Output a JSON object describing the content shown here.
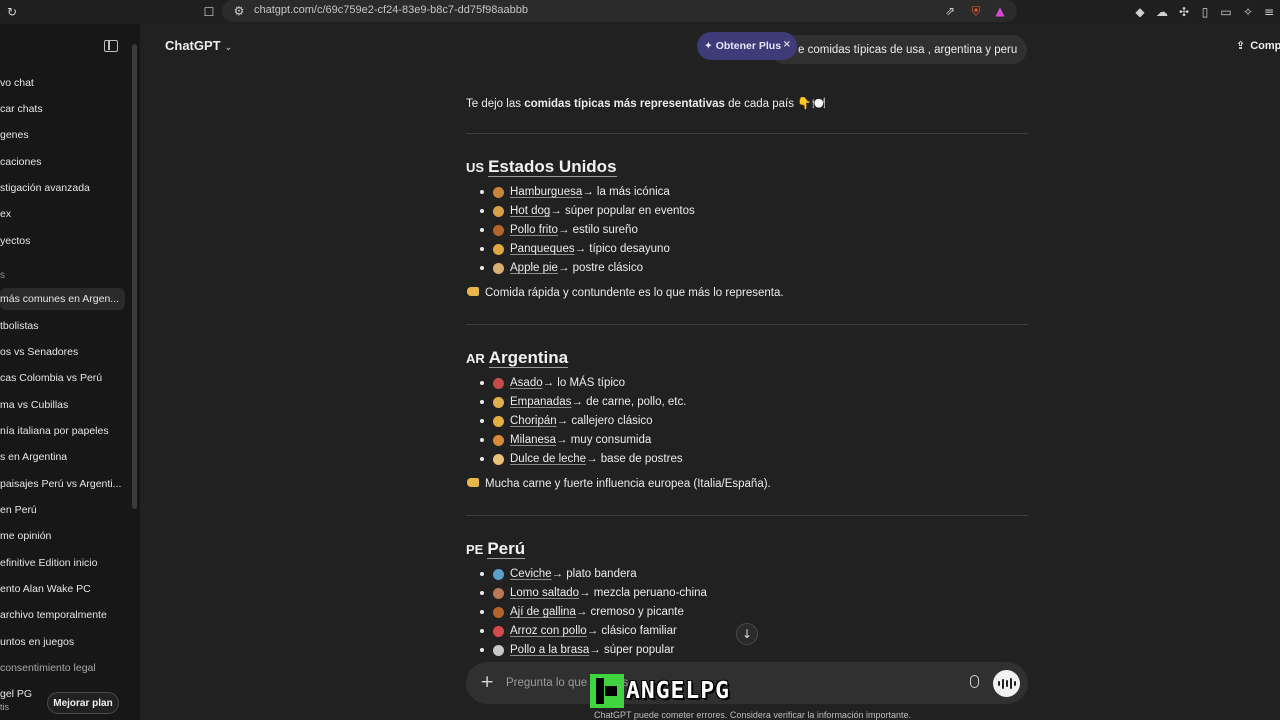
{
  "browser": {
    "url": "chatgpt.com/c/69c759e2-cf24-83e9-b8c7-dd75f98aabbb"
  },
  "sidebar": {
    "items": [
      {
        "label": "vo chat"
      },
      {
        "label": "car chats"
      },
      {
        "label": "genes"
      },
      {
        "label": "caciones"
      },
      {
        "label": "stigación avanzada"
      },
      {
        "label": "ex"
      },
      {
        "label": "yectos"
      }
    ],
    "section_label": "s",
    "chats": [
      {
        "label": " más comunes en Argen..."
      },
      {
        "label": "tbolistas"
      },
      {
        "label": "os vs Senadores"
      },
      {
        "label": "cas Colombia vs Perú"
      },
      {
        "label": "ma vs Cubillas"
      },
      {
        "label": "nía italiana por papeles"
      },
      {
        "label": "s en Argentina"
      },
      {
        "label": " paisajes Perú vs Argenti..."
      },
      {
        "label": " en Perú"
      },
      {
        "label": "me opinión"
      },
      {
        "label": "efinitive Edition inicio"
      },
      {
        "label": "ento Alan Wake PC"
      },
      {
        "label": "archivo temporalmente"
      },
      {
        "label": "untos en juegos"
      },
      {
        "label": " consentimiento legal"
      }
    ],
    "user_line1": "gel PG",
    "user_line2": "tis",
    "upgrade_label": "Mejorar plan"
  },
  "header": {
    "model": "ChatGPT",
    "plus_label": "✦ Obtener Plus",
    "plus_close": "×",
    "user_prompt": "e comidas típicas de usa , argentina y peru",
    "share_label": "Comp"
  },
  "answer": {
    "intro_pre": "Te dejo las ",
    "intro_bold": "comidas típicas más representativas",
    "intro_post": " de cada país 👇🍽️",
    "countries": [
      {
        "code": "US",
        "name": "Estados Unidos",
        "foods": [
          {
            "name": "Hamburguesa",
            "desc": " → la más icónica",
            "color": "#c9853a"
          },
          {
            "name": "Hot dog",
            "desc": " → súper popular en eventos",
            "color": "#d9a04a"
          },
          {
            "name": "Pollo frito",
            "desc": " → estilo sureño",
            "color": "#b5652a"
          },
          {
            "name": "Panqueques",
            "desc": " → típico desayuno",
            "color": "#e0a640"
          },
          {
            "name": "Apple pie",
            "desc": " → postre clásico",
            "color": "#d8b070"
          }
        ],
        "note": "Comida rápida y contundente es lo que más lo representa."
      },
      {
        "code": "AR",
        "name": "Argentina",
        "foods": [
          {
            "name": "Asado",
            "desc": " → lo MÁS típico",
            "color": "#c64a4a"
          },
          {
            "name": "Empanadas",
            "desc": " → de carne, pollo, etc.",
            "color": "#e1b04c"
          },
          {
            "name": "Choripán",
            "desc": " → callejero clásico",
            "color": "#e4b040"
          },
          {
            "name": "Milanesa",
            "desc": " → muy consumida",
            "color": "#d98a3a"
          },
          {
            "name": "Dulce de leche",
            "desc": " → base de postres",
            "color": "#e9c27a"
          }
        ],
        "note": "Mucha carne y fuerte influencia europea (Italia/España)."
      },
      {
        "code": "PE",
        "name": "Perú",
        "foods": [
          {
            "name": "Ceviche",
            "desc": " → plato bandera",
            "color": "#5aa0c8"
          },
          {
            "name": "Lomo saltado",
            "desc": " → mezcla peruano-china",
            "color": "#b97a55"
          },
          {
            "name": "Ají de gallina",
            "desc": " → cremoso y picante",
            "color": "#b5652a"
          },
          {
            "name": "Arroz con pollo",
            "desc": " → clásico familiar",
            "color": "#d44a4a"
          },
          {
            "name": "Pollo a la brasa",
            "desc": " → súper popular",
            "color": "#c8c8c8"
          }
        ]
      }
    ]
  },
  "composer": {
    "placeholder": "Pregunta lo que quieras",
    "disclaimer": "ChatGPT puede cometer errores. Considera verificar la información importante."
  },
  "watermark": {
    "text": "ANGELPG"
  }
}
